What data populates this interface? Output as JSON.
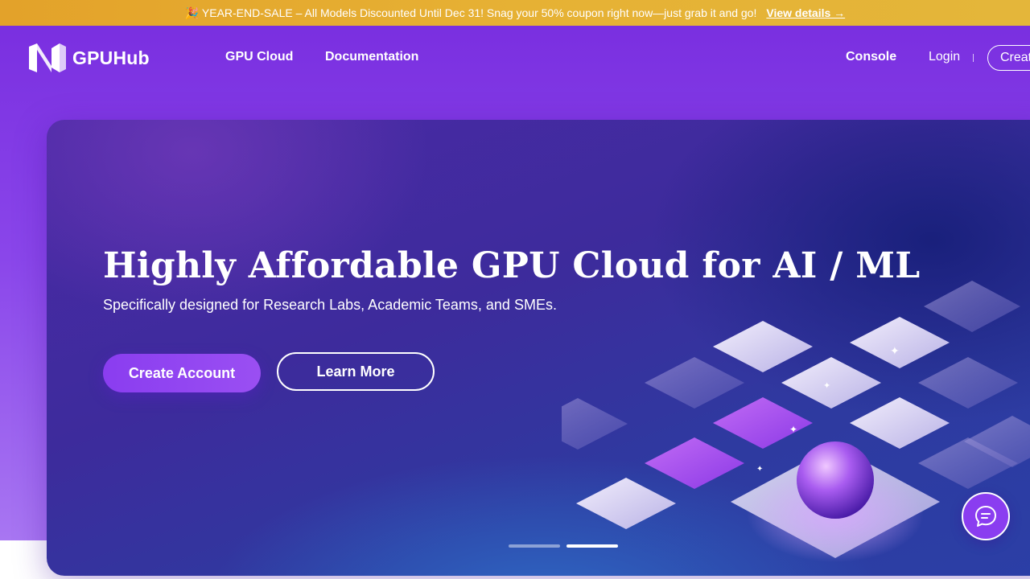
{
  "promo": {
    "text": "🎉 YEAR-END-SALE – All Models Discounted Until Dec 31! Snag your 50% coupon right now—just grab it and go!",
    "link_label": "View details →"
  },
  "header": {
    "logo_text": "GPUHub",
    "nav": {
      "gpu_cloud": "GPU Cloud",
      "documentation": "Documentation",
      "console": "Console",
      "login": "Login",
      "create": "Create Account"
    }
  },
  "hero": {
    "title": "Highly Affordable GPU Cloud for AI / ML",
    "subtitle": "Specifically designed for Research Labs, Academic Teams, and SMEs.",
    "primary_cta": "Create Account",
    "secondary_cta": "Learn More",
    "carousel": {
      "slides": 2,
      "active": 2
    }
  },
  "colors": {
    "promo_bg": "#e4ac2f",
    "brand_purple": "#7a2fe0",
    "button_purple": "#8a3df0"
  },
  "icons": {
    "logo": "gpuhub-logo-icon",
    "chat": "chat-bubble-icon"
  }
}
